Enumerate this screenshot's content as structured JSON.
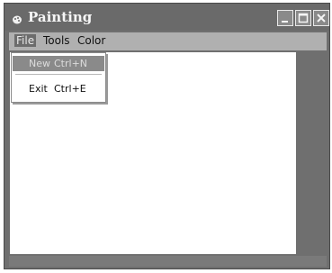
{
  "window": {
    "title": "Painting",
    "icon": "app-icon",
    "controls": [
      "minimize-icon",
      "maximize-icon",
      "close-icon"
    ]
  },
  "menubar": {
    "file_label": "File",
    "tools_label": "Tools",
    "color_label": "Color"
  },
  "file_menu": {
    "new_label": "New",
    "new_shortcut": "Ctrl+N",
    "exit_label": "Exit",
    "exit_shortcut": "Ctrl+E"
  },
  "colors": {
    "titlebar": "#6a6a6a",
    "menubar": "#b0b0b0",
    "highlight": "#8a8a8a",
    "canvas": "#ffffff"
  }
}
